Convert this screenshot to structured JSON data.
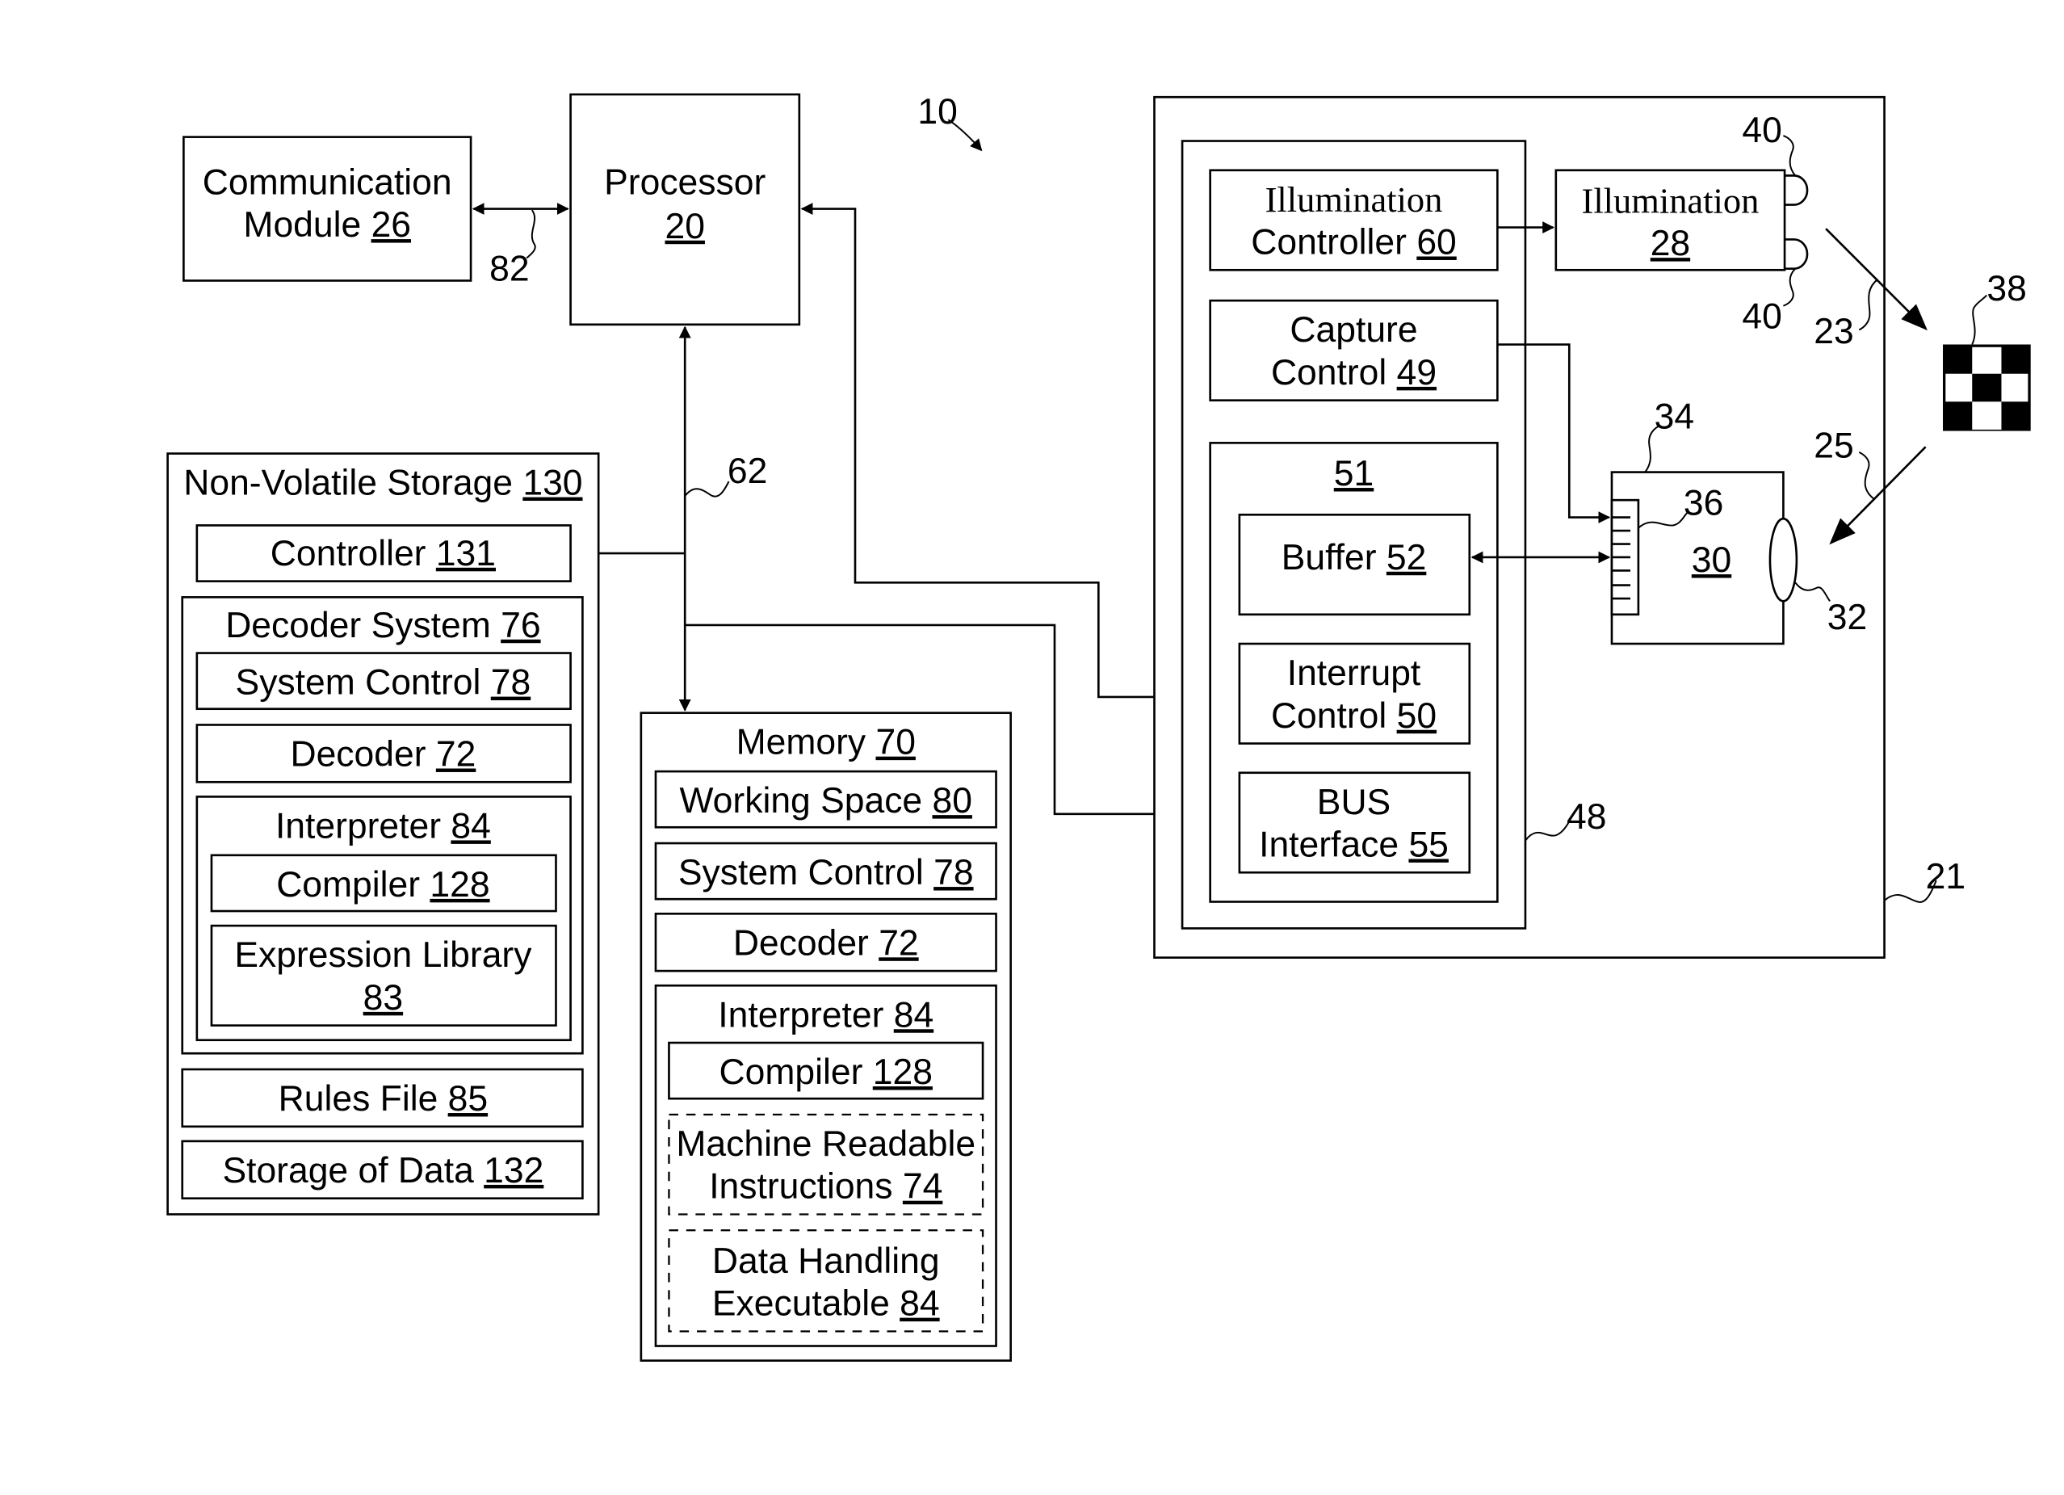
{
  "figure": {
    "system_ref": "10",
    "blocks": {
      "communication_module": {
        "line1": "Communication",
        "line2_text": "Module ",
        "ref": "26"
      },
      "processor": {
        "line1": "Processor",
        "ref": "20"
      },
      "non_volatile_storage": {
        "text": "Non-Volatile Storage ",
        "ref": "130"
      },
      "nvs_controller": {
        "text": "Controller ",
        "ref": "131"
      },
      "nvs_decoder_system": {
        "text": "Decoder System ",
        "ref": "76"
      },
      "nvs_system_control": {
        "text": "System Control ",
        "ref": "78"
      },
      "nvs_decoder": {
        "text": "Decoder ",
        "ref": "72"
      },
      "nvs_interpreter": {
        "text": "Interpreter ",
        "ref": "84"
      },
      "nvs_compiler": {
        "text": "Compiler ",
        "ref": "128"
      },
      "nvs_expression_library": {
        "line1": "Expression Library",
        "ref": "83"
      },
      "nvs_rules_file": {
        "text": "Rules File ",
        "ref": "85"
      },
      "nvs_storage_of_data": {
        "text": "Storage of Data ",
        "ref": "132"
      },
      "memory": {
        "text": "Memory ",
        "ref": "70"
      },
      "mem_working_space": {
        "text": "Working Space ",
        "ref": "80"
      },
      "mem_system_control": {
        "text": "System Control ",
        "ref": "78"
      },
      "mem_decoder": {
        "text": "Decoder ",
        "ref": "72"
      },
      "mem_interpreter": {
        "text": "Interpreter ",
        "ref": "84"
      },
      "mem_compiler": {
        "text": "Compiler ",
        "ref": "128"
      },
      "mem_machine_readable": {
        "line1": "Machine Readable",
        "line2_text": "Instructions ",
        "ref": "74"
      },
      "mem_data_handling": {
        "line1": "Data Handling",
        "line2_text": "Executable ",
        "ref": "84"
      },
      "illumination_controller": {
        "line1": "Illumination",
        "line2_text": "Controller ",
        "ref": "60"
      },
      "capture_control": {
        "line1": "Capture",
        "line2_text": "Control ",
        "ref": "49"
      },
      "block_51": {
        "ref": "51"
      },
      "buffer": {
        "text": "Buffer ",
        "ref": "52"
      },
      "interrupt_control": {
        "line1": "Interrupt",
        "line2_text": "Control ",
        "ref": "50"
      },
      "bus_interface": {
        "line1": "BUS",
        "line2_text": "Interface ",
        "ref": "55"
      },
      "illumination": {
        "line1": "Illumination",
        "ref": "28"
      },
      "imager": {
        "ref": "30"
      }
    },
    "callouts": {
      "link_82": "82",
      "bus_62": "62",
      "module_21": "21",
      "module_48": "48",
      "light_40_top": "40",
      "light_40_bottom": "40",
      "ray_23": "23",
      "ray_25": "25",
      "target_38": "38",
      "imager_34": "34",
      "sensor_36": "36",
      "lens_32": "32"
    }
  }
}
